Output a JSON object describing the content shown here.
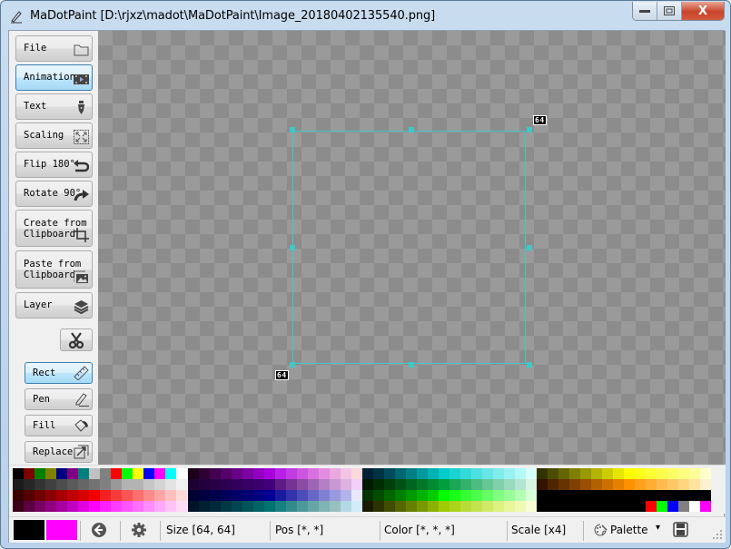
{
  "window": {
    "title": "MaDotPaint  [D:\\rjxz\\madot\\MaDotPaint\\Image_20180402135540.png]",
    "controls": {
      "minimize": "–",
      "maximize": "□",
      "close": "X"
    }
  },
  "sidebar": {
    "menu_buttons": [
      {
        "label": "File",
        "icon": "folder-icon",
        "active": false
      },
      {
        "label": "Animation",
        "icon": "film-icon",
        "active": true
      },
      {
        "label": "Text",
        "icon": "pen-nib-icon",
        "active": false
      },
      {
        "label": "Scaling",
        "icon": "expand-icon",
        "active": false
      },
      {
        "label": "Flip 180°",
        "icon": "undo-arrow-icon",
        "active": false
      },
      {
        "label": "Rotate 90°",
        "icon": "redo-arrow-icon",
        "active": false
      },
      {
        "label": "Create from\nClipboard",
        "icon": "crop-icon",
        "active": false
      },
      {
        "label": "Paste from\nClipboard",
        "icon": "image-icon",
        "active": false
      },
      {
        "label": "Layer",
        "icon": "layers-icon",
        "active": false
      }
    ],
    "cut_button": {
      "icon": "scissors-icon"
    },
    "tools": [
      {
        "label": "Rect",
        "icon": "ruler-icon",
        "active": true
      },
      {
        "label": "Pen",
        "icon": "pencil-icon",
        "active": false
      },
      {
        "label": "Fill",
        "icon": "paint-bucket-icon",
        "active": false
      },
      {
        "label": "Replace",
        "icon": "replace-icon",
        "active": false
      }
    ]
  },
  "canvas": {
    "width_label": "64",
    "height_label": "64",
    "selection_color": "#40c8c8"
  },
  "palette": {
    "groups": [
      [
        "#000000",
        "#800000",
        "#008000",
        "#808000",
        "#000080",
        "#800080",
        "#008080",
        "#c0c0c0",
        "#808080",
        "#ff0000",
        "#00ff00",
        "#ffff00",
        "#0000ff",
        "#ff00ff",
        "#00ffff",
        "#ffffff",
        "#1c1c1c",
        "#262626",
        "#333333",
        "#404040",
        "#4d4d4d",
        "#5a5a5a",
        "#666666",
        "#737373",
        "#808080",
        "#999999",
        "#b3b3b3",
        "#b3b3b3",
        "#c6c6c6",
        "#d4d4d4",
        "#e3e3e3",
        "#f0f0f0",
        "#3a0000",
        "#550000",
        "#700000",
        "#8b0000",
        "#a60000",
        "#c10000",
        "#d70000",
        "#f20000",
        "#f22020",
        "#f73a3a",
        "#f95555",
        "#fb6f6f",
        "#fc8a8a",
        "#fda5a5",
        "#fdc0c0",
        "#fedada",
        "#3c0018",
        "#5a0040",
        "#780060",
        "#900080",
        "#a800a0",
        "#c000c0",
        "#e000e0",
        "#ff00ff",
        "#ff20ff",
        "#ff3cff",
        "#ff55ff",
        "#ff70ff",
        "#ff8cff",
        "#ffa8ff",
        "#ffc4f4",
        "#ffdcf6"
      ],
      [
        "#1a0018",
        "#2e0033",
        "#420050",
        "#55006b",
        "#690087",
        "#7d00a3",
        "#9100c0",
        "#a800dc",
        "#b820e8",
        "#c23ae4",
        "#cd55e0",
        "#d870e0",
        "#e28ce0",
        "#eaa8e0",
        "#f4c4e4",
        "#fdd8d8",
        "#1e0033",
        "#23003d",
        "#280047",
        "#2d0050",
        "#32005a",
        "#370064",
        "#3c006e",
        "#41007a",
        "#5e1a85",
        "#763294",
        "#8a4ba4",
        "#9f64b3",
        "#b47ec3",
        "#c898d2",
        "#ddb2e2",
        "#f3d0f8",
        "#000033",
        "#000040",
        "#00004d",
        "#00005a",
        "#000068",
        "#000075",
        "#000083",
        "#000096",
        "#1a1a9f",
        "#3333ad",
        "#4d4dba",
        "#6767c7",
        "#8080d3",
        "#9999df",
        "#b3b3ec",
        "#e8e8f8",
        "#001428",
        "#002032",
        "#00283c",
        "#003746",
        "#004650",
        "#00555a",
        "#006464",
        "#00736e",
        "#1a8080",
        "#338c8c",
        "#4d9999",
        "#66a6a6",
        "#80b3b3",
        "#99c0c0",
        "#b3d8e6",
        "#d4ecf8"
      ],
      [
        "#002033",
        "#003344",
        "#004c5a",
        "#006670",
        "#007f86",
        "#00999c",
        "#00b2b2",
        "#00cccc",
        "#1ad3d3",
        "#33dada",
        "#4de0e0",
        "#66e6e6",
        "#80ecec",
        "#99f2f2",
        "#b3f8f8",
        "#d8ffff",
        "#001800",
        "#002c00",
        "#003f0a",
        "#005214",
        "#00651e",
        "#007828",
        "#008b32",
        "#009e3c",
        "#1aa855",
        "#33b26b",
        "#4dbc80",
        "#66c696",
        "#80d0ab",
        "#99dabf",
        "#b3e4d4",
        "#d8f4e4",
        "#003300",
        "#004d00",
        "#006600",
        "#008000",
        "#009900",
        "#00b300",
        "#00cc00",
        "#00ff00",
        "#1aff1a",
        "#33ff33",
        "#4dff4d",
        "#66ff66",
        "#80ff80",
        "#99ff99",
        "#b3ffb3",
        "#d8ffd8",
        "#1a1a00",
        "#2d3300",
        "#404d00",
        "#536600",
        "#668000",
        "#799900",
        "#8cb300",
        "#9fcc00",
        "#abd41a",
        "#b7dc33",
        "#c3e34d",
        "#cfea66",
        "#dbf180",
        "#e7f799",
        "#f1fab3",
        "#f8fdd8"
      ],
      [
        "#333300",
        "#4d4d00",
        "#666600",
        "#808000",
        "#999900",
        "#b3b300",
        "#cccc00",
        "#e6e600",
        "#ffff00",
        "#ffff1a",
        "#ffff33",
        "#ffff4d",
        "#ffff66",
        "#ffff80",
        "#ffff99",
        "#ffffcc",
        "#331400",
        "#4d2600",
        "#663300",
        "#804000",
        "#995000",
        "#b36000",
        "#cc7000",
        "#e68000",
        "#ff9000",
        "#ff9f1a",
        "#ffad33",
        "#ffbb4d",
        "#ffc866",
        "#ffd680",
        "#ffe4a0",
        "#fff0d0",
        "#000000",
        "#000000",
        "#000000",
        "#000000",
        "#000000",
        "#000000",
        "#000000",
        "#000000",
        "#000000",
        "#000000",
        "#000000",
        "#000000",
        "#000000",
        "#000000",
        "#000000",
        "#000000",
        "#000000",
        "#000000",
        "#000000",
        "#000000",
        "#000000",
        "#000000",
        "#000000",
        "#000000",
        "#000000",
        "#000000",
        "#ff0000",
        "#00ff00",
        "#0000ff",
        "#808080",
        "#ffffff",
        "#ff00ff"
      ]
    ]
  },
  "status": {
    "primary_color": "#000000",
    "secondary_color": "#ff00ff",
    "size": "Size [64, 64]",
    "pos": "Pos [*, *]",
    "color": "Color [*, *, *]",
    "scale": "Scale [x4]",
    "palette_label": "Palette",
    "dropdown_arrow": "▾"
  }
}
